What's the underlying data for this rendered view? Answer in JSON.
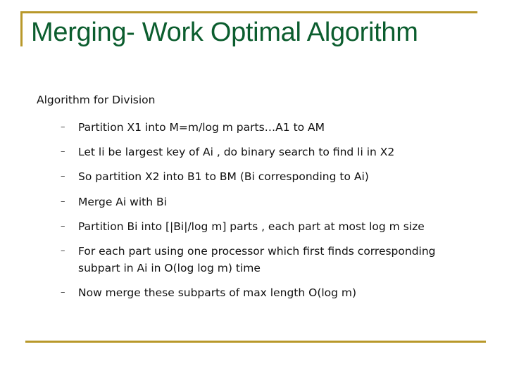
{
  "slide": {
    "title": "Merging- Work Optimal Algorithm",
    "subheading": "Algorithm for Division",
    "bullet_marker": "–",
    "bullets": [
      {
        "text": "Partition X1 into M=m/log m parts…A1 to AM"
      },
      {
        "text": "Let li be largest key of Ai , do binary search to find li in X2"
      },
      {
        "text": "So partition X2 into B1 to BM (Bi corresponding to Ai)"
      },
      {
        "text": "Merge Ai with Bi"
      },
      {
        "text": "Partition Bi into [|Bi|/log m] parts , each part at most log m size"
      },
      {
        "text": "For each part using one processor which first finds corresponding\nsubpart in  Ai in O(log log m) time"
      },
      {
        "text": "Now merge these subparts of max length O(log m)"
      }
    ],
    "colors": {
      "title": "#0b5d2e",
      "accent_rule": "#b8982a",
      "body_text": "#111111"
    }
  }
}
